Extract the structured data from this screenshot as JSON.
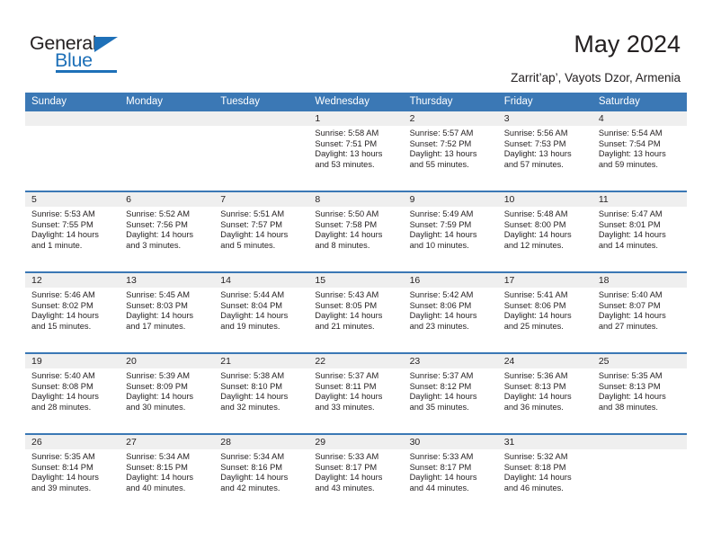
{
  "brand": {
    "name_part1": "General",
    "name_part2": "Blue",
    "triangle_icon": "triangle-icon",
    "accent_color": "#1e70b8"
  },
  "header": {
    "title": "May 2024",
    "subtitle": "Zarrit’ap’, Vayots Dzor, Armenia",
    "header_bg_color": "#3b78b5",
    "daynum_bg_color": "#efefef"
  },
  "weekday_headers": [
    "Sunday",
    "Monday",
    "Tuesday",
    "Wednesday",
    "Thursday",
    "Friday",
    "Saturday"
  ],
  "weeks": [
    [
      {
        "day": "",
        "sunrise": "",
        "sunset": "",
        "daylight": "",
        "empty": true
      },
      {
        "day": "",
        "sunrise": "",
        "sunset": "",
        "daylight": "",
        "empty": true
      },
      {
        "day": "",
        "sunrise": "",
        "sunset": "",
        "daylight": "",
        "empty": true
      },
      {
        "day": "1",
        "sunrise": "Sunrise: 5:58 AM",
        "sunset": "Sunset: 7:51 PM",
        "daylight": "Daylight: 13 hours and 53 minutes."
      },
      {
        "day": "2",
        "sunrise": "Sunrise: 5:57 AM",
        "sunset": "Sunset: 7:52 PM",
        "daylight": "Daylight: 13 hours and 55 minutes."
      },
      {
        "day": "3",
        "sunrise": "Sunrise: 5:56 AM",
        "sunset": "Sunset: 7:53 PM",
        "daylight": "Daylight: 13 hours and 57 minutes."
      },
      {
        "day": "4",
        "sunrise": "Sunrise: 5:54 AM",
        "sunset": "Sunset: 7:54 PM",
        "daylight": "Daylight: 13 hours and 59 minutes."
      }
    ],
    [
      {
        "day": "5",
        "sunrise": "Sunrise: 5:53 AM",
        "sunset": "Sunset: 7:55 PM",
        "daylight": "Daylight: 14 hours and 1 minute."
      },
      {
        "day": "6",
        "sunrise": "Sunrise: 5:52 AM",
        "sunset": "Sunset: 7:56 PM",
        "daylight": "Daylight: 14 hours and 3 minutes."
      },
      {
        "day": "7",
        "sunrise": "Sunrise: 5:51 AM",
        "sunset": "Sunset: 7:57 PM",
        "daylight": "Daylight: 14 hours and 5 minutes."
      },
      {
        "day": "8",
        "sunrise": "Sunrise: 5:50 AM",
        "sunset": "Sunset: 7:58 PM",
        "daylight": "Daylight: 14 hours and 8 minutes."
      },
      {
        "day": "9",
        "sunrise": "Sunrise: 5:49 AM",
        "sunset": "Sunset: 7:59 PM",
        "daylight": "Daylight: 14 hours and 10 minutes."
      },
      {
        "day": "10",
        "sunrise": "Sunrise: 5:48 AM",
        "sunset": "Sunset: 8:00 PM",
        "daylight": "Daylight: 14 hours and 12 minutes."
      },
      {
        "day": "11",
        "sunrise": "Sunrise: 5:47 AM",
        "sunset": "Sunset: 8:01 PM",
        "daylight": "Daylight: 14 hours and 14 minutes."
      }
    ],
    [
      {
        "day": "12",
        "sunrise": "Sunrise: 5:46 AM",
        "sunset": "Sunset: 8:02 PM",
        "daylight": "Daylight: 14 hours and 15 minutes."
      },
      {
        "day": "13",
        "sunrise": "Sunrise: 5:45 AM",
        "sunset": "Sunset: 8:03 PM",
        "daylight": "Daylight: 14 hours and 17 minutes."
      },
      {
        "day": "14",
        "sunrise": "Sunrise: 5:44 AM",
        "sunset": "Sunset: 8:04 PM",
        "daylight": "Daylight: 14 hours and 19 minutes."
      },
      {
        "day": "15",
        "sunrise": "Sunrise: 5:43 AM",
        "sunset": "Sunset: 8:05 PM",
        "daylight": "Daylight: 14 hours and 21 minutes."
      },
      {
        "day": "16",
        "sunrise": "Sunrise: 5:42 AM",
        "sunset": "Sunset: 8:06 PM",
        "daylight": "Daylight: 14 hours and 23 minutes."
      },
      {
        "day": "17",
        "sunrise": "Sunrise: 5:41 AM",
        "sunset": "Sunset: 8:06 PM",
        "daylight": "Daylight: 14 hours and 25 minutes."
      },
      {
        "day": "18",
        "sunrise": "Sunrise: 5:40 AM",
        "sunset": "Sunset: 8:07 PM",
        "daylight": "Daylight: 14 hours and 27 minutes."
      }
    ],
    [
      {
        "day": "19",
        "sunrise": "Sunrise: 5:40 AM",
        "sunset": "Sunset: 8:08 PM",
        "daylight": "Daylight: 14 hours and 28 minutes."
      },
      {
        "day": "20",
        "sunrise": "Sunrise: 5:39 AM",
        "sunset": "Sunset: 8:09 PM",
        "daylight": "Daylight: 14 hours and 30 minutes."
      },
      {
        "day": "21",
        "sunrise": "Sunrise: 5:38 AM",
        "sunset": "Sunset: 8:10 PM",
        "daylight": "Daylight: 14 hours and 32 minutes."
      },
      {
        "day": "22",
        "sunrise": "Sunrise: 5:37 AM",
        "sunset": "Sunset: 8:11 PM",
        "daylight": "Daylight: 14 hours and 33 minutes."
      },
      {
        "day": "23",
        "sunrise": "Sunrise: 5:37 AM",
        "sunset": "Sunset: 8:12 PM",
        "daylight": "Daylight: 14 hours and 35 minutes."
      },
      {
        "day": "24",
        "sunrise": "Sunrise: 5:36 AM",
        "sunset": "Sunset: 8:13 PM",
        "daylight": "Daylight: 14 hours and 36 minutes."
      },
      {
        "day": "25",
        "sunrise": "Sunrise: 5:35 AM",
        "sunset": "Sunset: 8:13 PM",
        "daylight": "Daylight: 14 hours and 38 minutes."
      }
    ],
    [
      {
        "day": "26",
        "sunrise": "Sunrise: 5:35 AM",
        "sunset": "Sunset: 8:14 PM",
        "daylight": "Daylight: 14 hours and 39 minutes."
      },
      {
        "day": "27",
        "sunrise": "Sunrise: 5:34 AM",
        "sunset": "Sunset: 8:15 PM",
        "daylight": "Daylight: 14 hours and 40 minutes."
      },
      {
        "day": "28",
        "sunrise": "Sunrise: 5:34 AM",
        "sunset": "Sunset: 8:16 PM",
        "daylight": "Daylight: 14 hours and 42 minutes."
      },
      {
        "day": "29",
        "sunrise": "Sunrise: 5:33 AM",
        "sunset": "Sunset: 8:17 PM",
        "daylight": "Daylight: 14 hours and 43 minutes."
      },
      {
        "day": "30",
        "sunrise": "Sunrise: 5:33 AM",
        "sunset": "Sunset: 8:17 PM",
        "daylight": "Daylight: 14 hours and 44 minutes."
      },
      {
        "day": "31",
        "sunrise": "Sunrise: 5:32 AM",
        "sunset": "Sunset: 8:18 PM",
        "daylight": "Daylight: 14 hours and 46 minutes."
      },
      {
        "day": "",
        "sunrise": "",
        "sunset": "",
        "daylight": "",
        "empty": true
      }
    ]
  ]
}
